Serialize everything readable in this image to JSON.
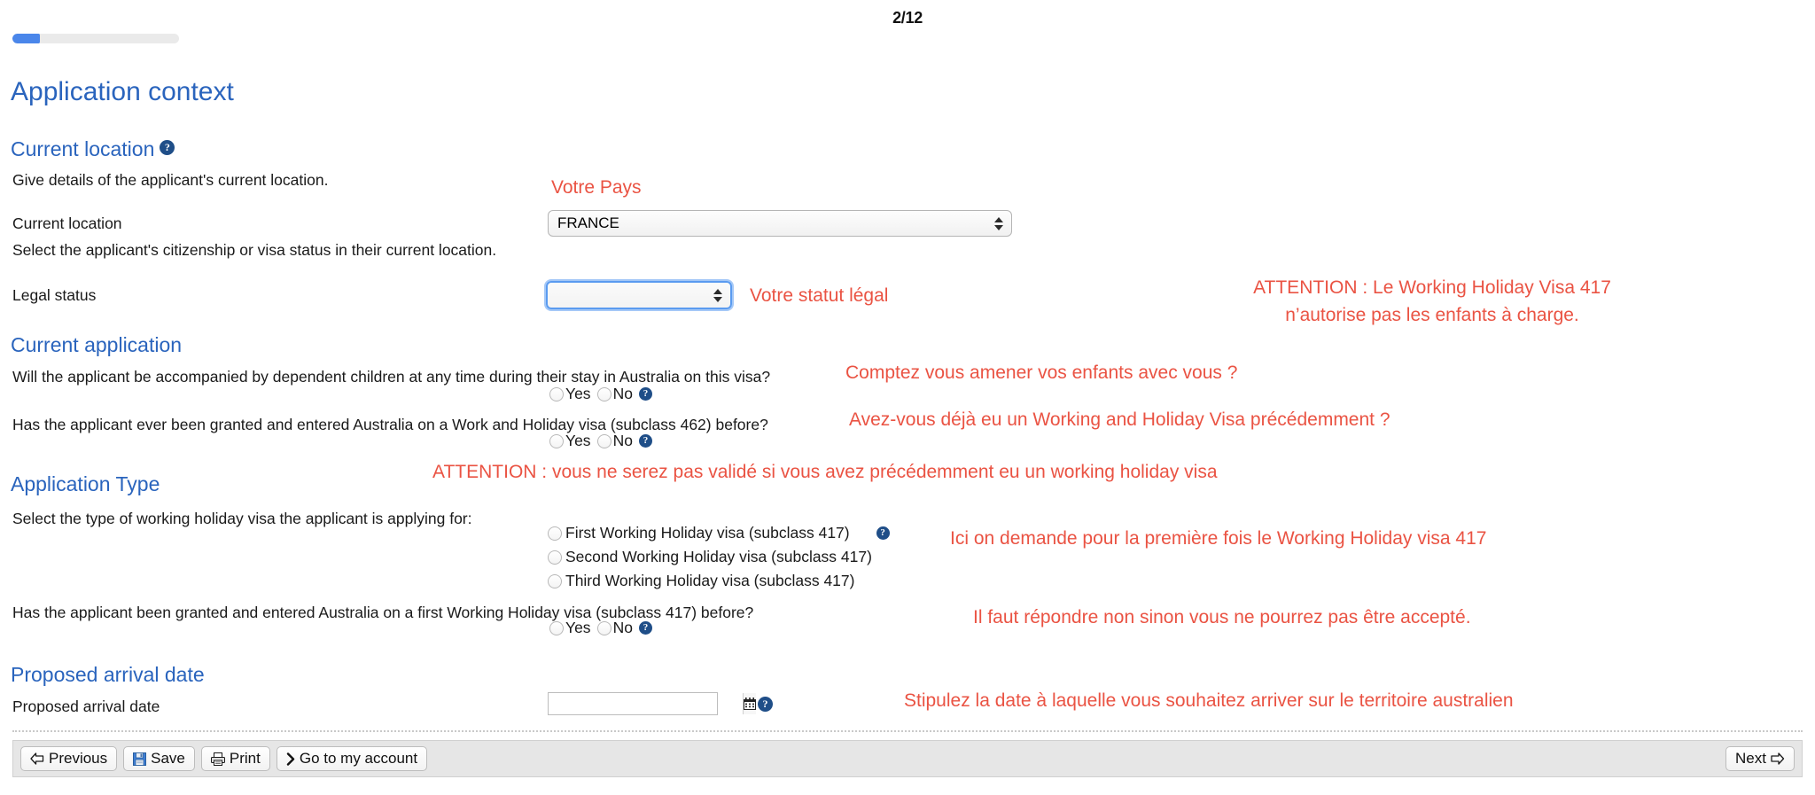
{
  "header": {
    "page_counter": "2/12",
    "progress_percent": 16.7,
    "progress_color": "#4a86ea"
  },
  "page_title": "Application context",
  "sections": {
    "current_location": {
      "heading": "Current location",
      "help_icon": "help-icon",
      "description": "Give details of the applicant's current location.",
      "location_label": "Current location",
      "location_value": "FRANCE",
      "status_description": "Select the applicant's citizenship or visa status in their current location.",
      "legal_status_label": "Legal status",
      "legal_status_value": ""
    },
    "current_application": {
      "heading": "Current application",
      "q1": "Will the applicant be accompanied by dependent children at any time during their stay in Australia on this visa?",
      "q2": "Has the applicant ever been granted and entered Australia on a Work and Holiday visa (subclass 462) before?",
      "yes_label": "Yes",
      "no_label": "No"
    },
    "application_type": {
      "heading": "Application Type",
      "description": "Select the type of working holiday visa the applicant is applying for:",
      "options": [
        "First Working Holiday visa (subclass 417)",
        "Second Working Holiday visa (subclass 417)",
        "Third Working Holiday visa (subclass 417)"
      ],
      "q3": "Has the applicant been granted and entered Australia on a first Working Holiday visa (subclass 417) before?",
      "yes_label": "Yes",
      "no_label": "No"
    },
    "proposed_arrival": {
      "heading": "Proposed arrival date",
      "label": "Proposed arrival date",
      "value": "",
      "calendar_icon": "calendar-icon"
    }
  },
  "annotations": {
    "color": "#ea5343",
    "country": "Votre Pays",
    "legal_status": "Votre statut légal",
    "no_children_line1": "ATTENTION : Le Working Holiday Visa 417",
    "no_children_line2": "n’autorise pas les enfants à charge.",
    "children_question": "Comptez vous amener vos enfants avec vous ?",
    "previous_whv": "Avez-vous déjà eu un Working and Holiday Visa précédemment ?",
    "attention_validation": "ATTENTION : vous ne serez pas validé si vous avez précédemment eu un working holiday visa",
    "first_request": "Ici on demande pour la première fois le Working Holiday visa 417",
    "answer_no": "Il faut répondre non sinon vous ne pourrez pas être accepté.",
    "arrival_date": "Stipulez la date à laquelle vous souhaitez arriver sur le territoire australien"
  },
  "footer": {
    "previous_label": "Previous",
    "save_label": "Save",
    "print_label": "Print",
    "account_label": "Go to my account",
    "next_label": "Next"
  }
}
